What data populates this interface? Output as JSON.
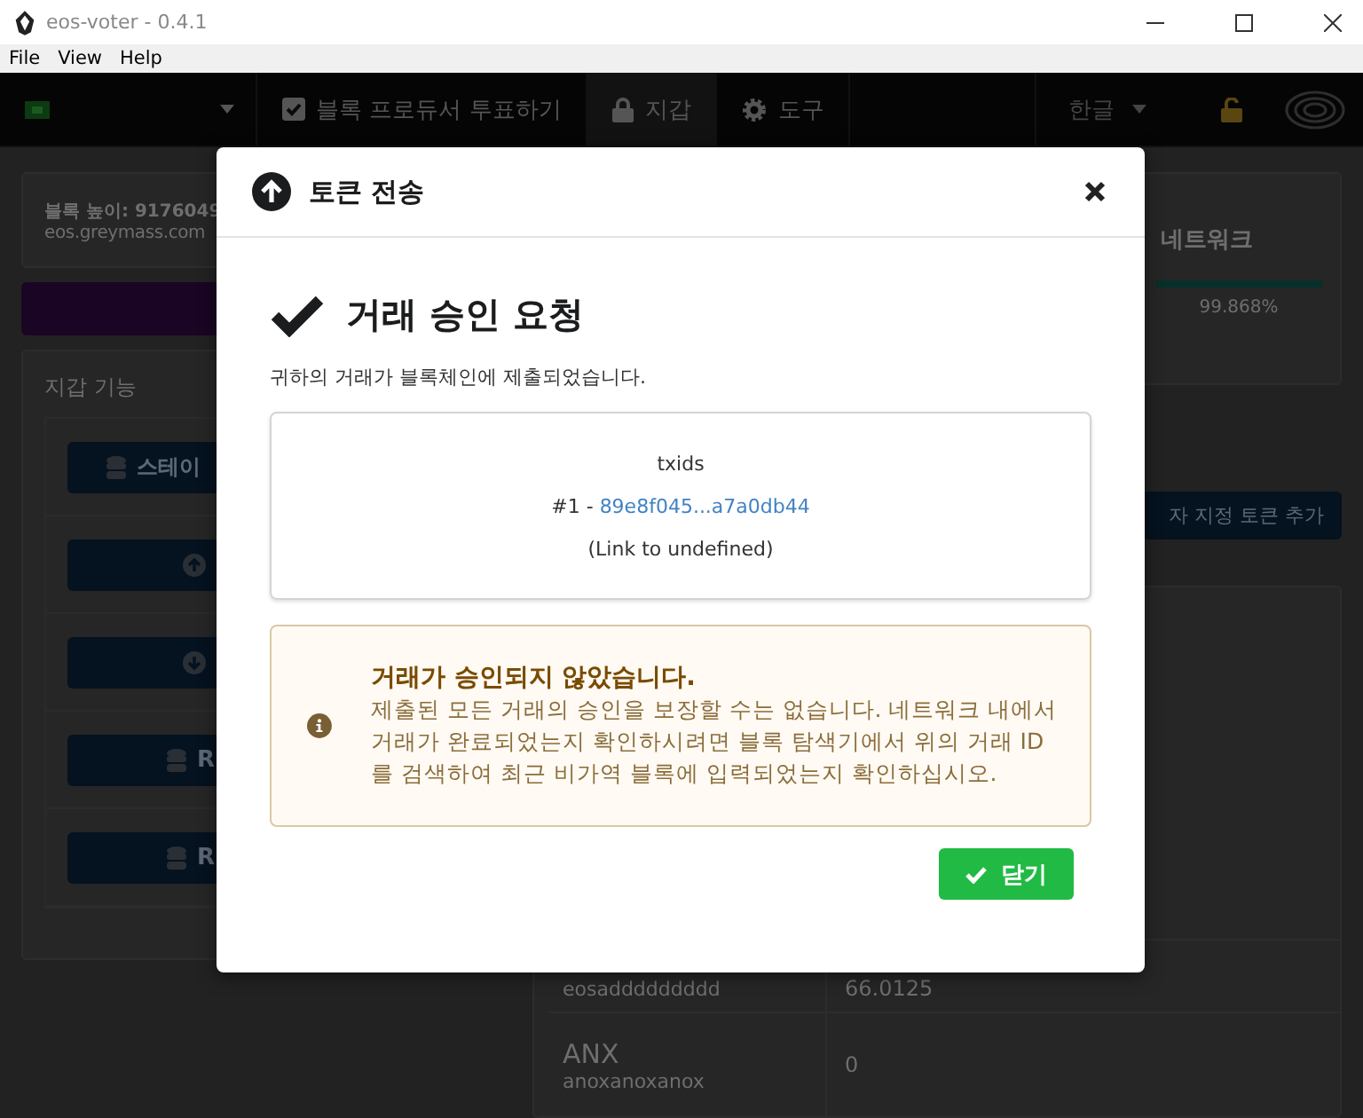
{
  "window": {
    "title": "eos-voter - 0.4.1"
  },
  "menu": [
    "File",
    "View",
    "Help"
  ],
  "nav": {
    "tabs": [
      {
        "kind": "vote",
        "label": "블록 프로듀서 투표하기",
        "selected": false
      },
      {
        "kind": "wallet",
        "label": "지갑",
        "selected": true
      },
      {
        "kind": "tools",
        "label": "도구",
        "selected": false
      }
    ],
    "language": "한글"
  },
  "block_info": {
    "height": "블록 높이: 9176049",
    "node": "eos.greymass.com"
  },
  "wallet_panel": {
    "title": "지갑 기능",
    "buttons": [
      {
        "kind": "stake",
        "label": "스테이"
      },
      {
        "kind": "send"
      },
      {
        "kind": "receive"
      },
      {
        "kind": "ram",
        "label": "R"
      },
      {
        "kind": "ram",
        "label": "R"
      }
    ]
  },
  "network": {
    "title": "네트워크",
    "level": 0.99868,
    "reading": "99.868%"
  },
  "custom_token_button": "자 지정 토큰 추가",
  "tokens": [
    {
      "account": "eosaddddddddd",
      "balance": "66.0125"
    },
    {
      "symbol": "ANX",
      "account": "anoxanoxanox",
      "balance": "0"
    }
  ],
  "modal": {
    "title": "토큰 전송",
    "heading": "거래 승인 요청",
    "message": "귀하의 거래가 블록체인에 제출되었습니다.",
    "txids": {
      "title": "txids",
      "items": [
        {
          "index": "#1 -",
          "id": "89e8f045...a7a0db44"
        }
      ],
      "note": "(Link to undefined)"
    },
    "warning": {
      "title": "거래가 승인되지 않았습니다.",
      "body": "제출된 모든 거래의 승인을 보장할 수는 없습니다. 네트워크 내에서 거래가 완료되었는지 확인하시려면 블록 탐색기에서 위의 거래 ID를 검색하여 최근 비가역 블록에 입력되었는지 확인하십시오."
    },
    "button": "닫기"
  }
}
